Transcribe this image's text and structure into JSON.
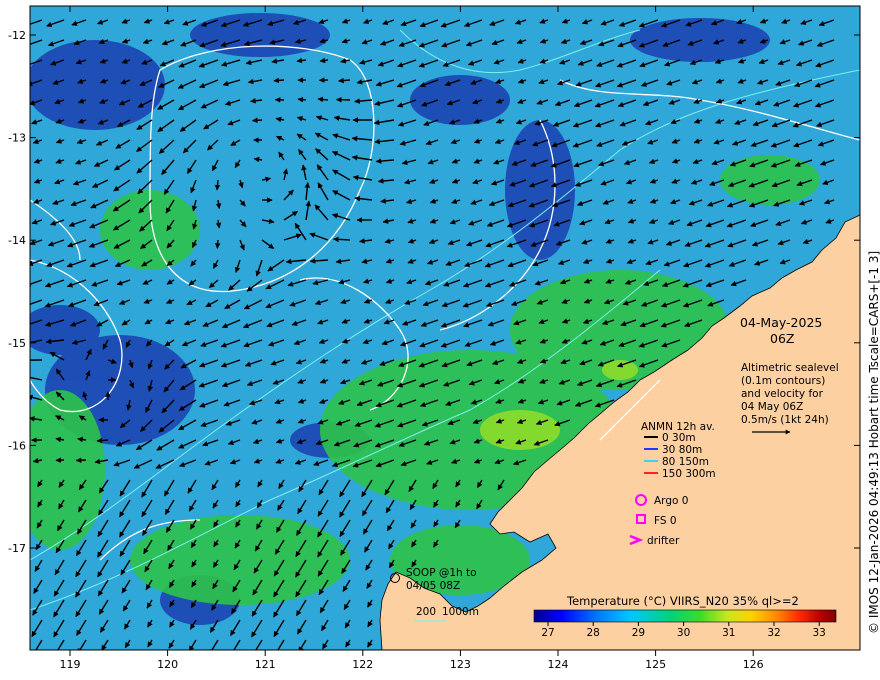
{
  "map": {
    "x_ticks": [
      "119",
      "120",
      "121",
      "122",
      "123",
      "124",
      "125",
      "126"
    ],
    "y_ticks": [
      "-12",
      "-13",
      "-14",
      "-15",
      "-16",
      "-17"
    ],
    "colors": {
      "ocean_base": "#2fa7d9",
      "ocean_cool": "#1b3fb0",
      "ocean_warm": "#2ec24a",
      "land": "#fdd0a2",
      "arrow": "#000000",
      "contour": "#ffffff",
      "bathy": "#7ff0f0"
    }
  },
  "date_block": {
    "date": "04-May-2025",
    "hour": "06Z"
  },
  "description": {
    "line1": "Altimetric sealevel",
    "line2": "(0.1m contours)",
    "line3": "and velocity for",
    "line4": "04 May 06Z",
    "line5": "0.5m/s (1kt 24h)"
  },
  "anmn_legend": {
    "title": "ANMN 12h av.",
    "items": [
      {
        "label": "0 30m",
        "color": "#000000"
      },
      {
        "label": "30 80m",
        "color": "#1a3cff"
      },
      {
        "label": "80 150m",
        "color": "#3cd0ff"
      },
      {
        "label": "150 300m",
        "color": "#ff2020"
      }
    ]
  },
  "obs_legend": {
    "argo": "Argo 0",
    "fs": "FS 0",
    "drifter": "drifter",
    "marker_color": "#ff00ff"
  },
  "soop": {
    "line1": "SOOP @1h to",
    "line2": "04/05 08Z"
  },
  "depth_legend": {
    "d1": "200",
    "d2": "1000m"
  },
  "colorbar": {
    "title": "Temperature (°C) VIIRS_N20 35% ql>=2",
    "ticks": [
      "27",
      "28",
      "29",
      "30",
      "31",
      "32",
      "33"
    ],
    "colors": [
      "#00008f",
      "#0000ff",
      "#0070ff",
      "#00c8ff",
      "#00d27a",
      "#3adc28",
      "#c8e61e",
      "#ffd200",
      "#ff8c00",
      "#ff2800",
      "#b40000",
      "#800000"
    ]
  },
  "side_caption": "© IMOS 12-Jan-2026 04:49:13 Hobart time Tscale=CARS+[-1 3]"
}
